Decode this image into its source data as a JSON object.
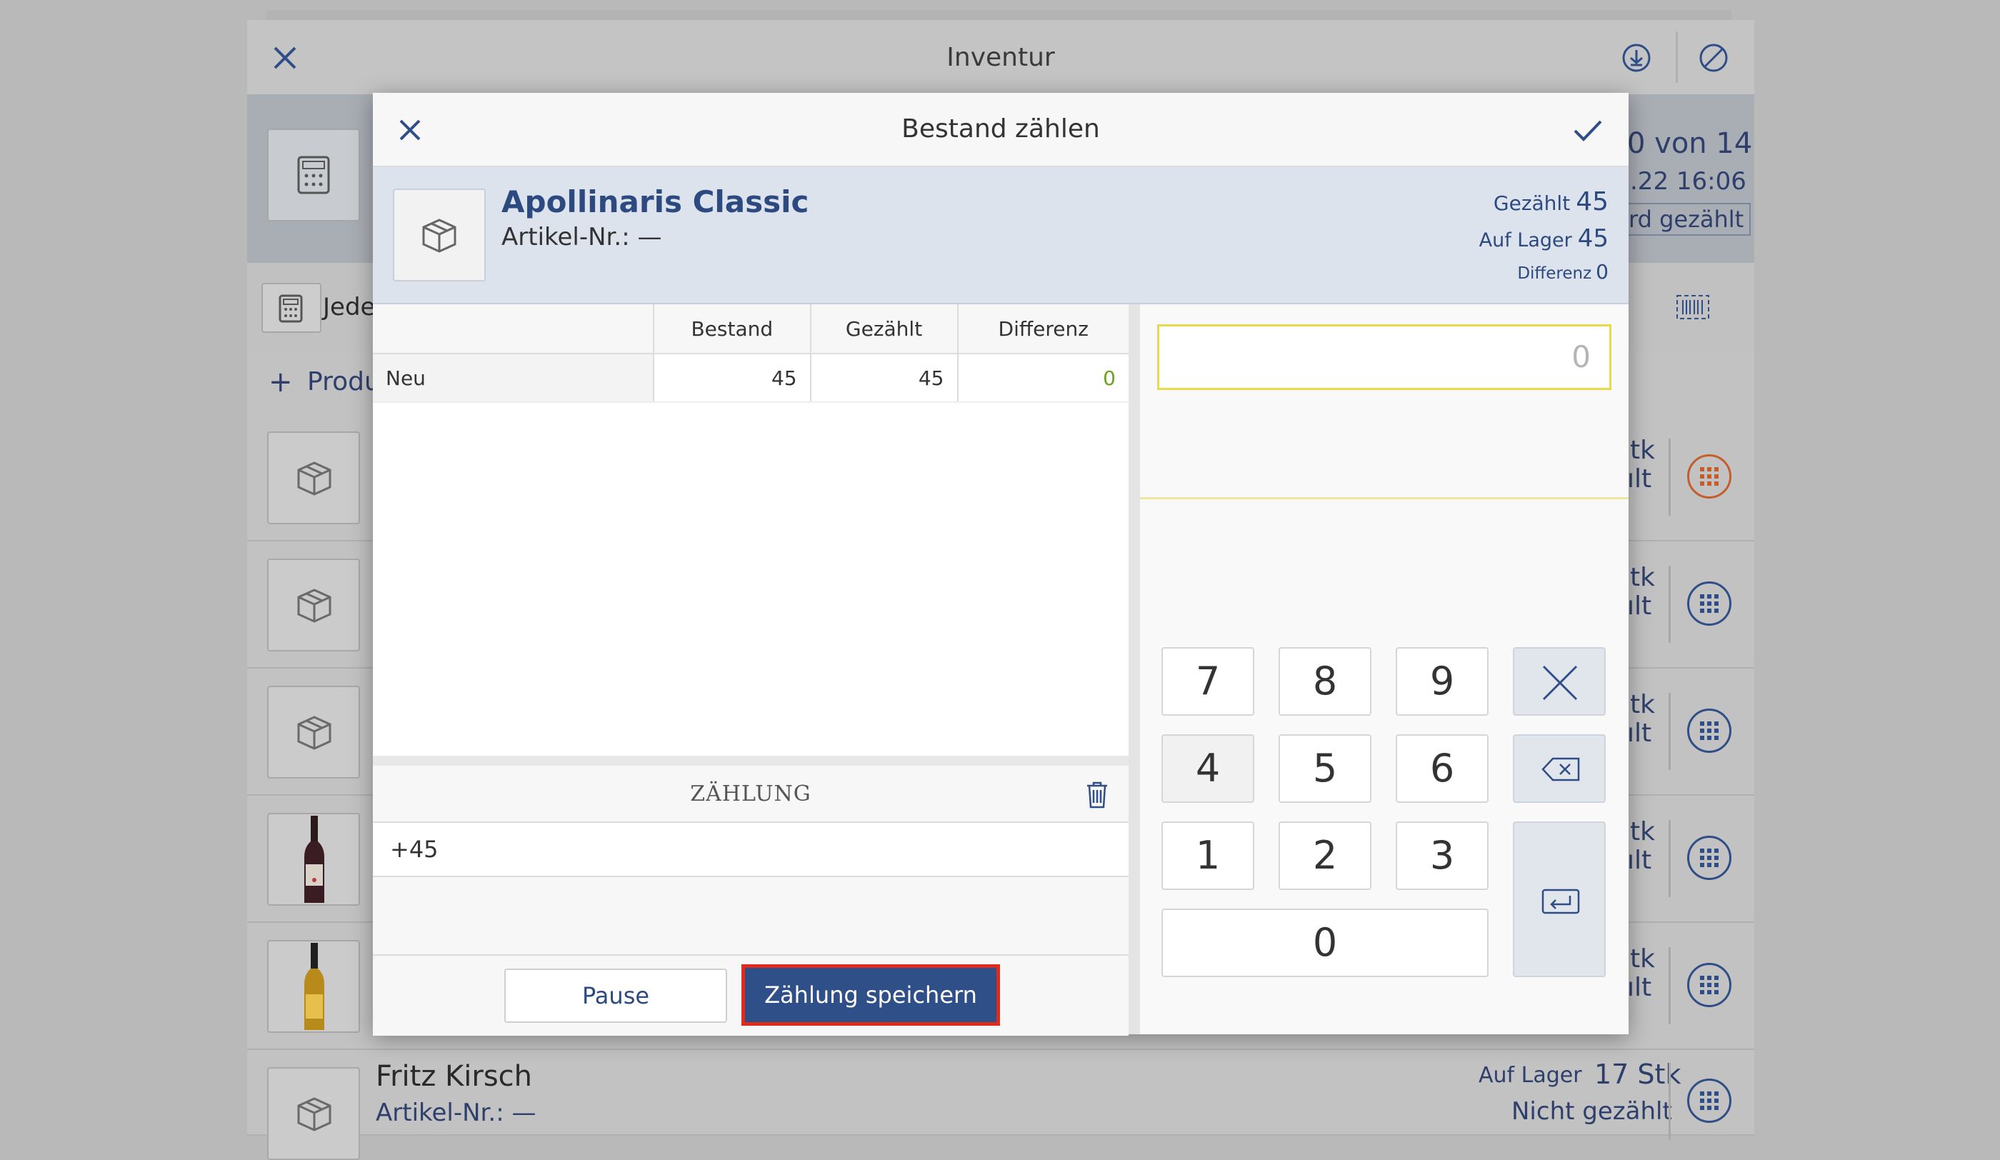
{
  "background": {
    "title": "Inventur",
    "count_text": "0 von 14",
    "date_text": ".22 16:06",
    "badge_text": "rd gezählt",
    "filter_text": "Jede",
    "add_text": "Produ",
    "row_partial_1": "tk",
    "row_partial_2": "ılt",
    "last_row": {
      "name": "Fritz Kirsch",
      "nr": "Artikel-Nr.: —",
      "stock_label": "Auf Lager",
      "stock_value": "17 Stk",
      "status": "Nicht gezählt"
    },
    "icons": [
      "close-icon",
      "download-icon",
      "cancel-icon",
      "calculator-icon",
      "barcode-icon",
      "box-icon",
      "bottle-image",
      "grid-icon"
    ]
  },
  "modal": {
    "title": "Bestand zählen",
    "product": {
      "name": "Apollinaris Classic",
      "nr": "Artikel-Nr.: —",
      "counted_label": "Gezählt",
      "counted_value": "45",
      "stock_label": "Auf Lager",
      "stock_value": "45",
      "diff_label": "Differenz",
      "diff_value": "0"
    },
    "table": {
      "headers": [
        "",
        "Bestand",
        "Gezählt",
        "Differenz"
      ],
      "rows": [
        {
          "label": "Neu",
          "bestand": "45",
          "gezaehlt": "45",
          "differenz": "0"
        }
      ]
    },
    "zaehlung": {
      "title": "ZÄHLUNG",
      "entries": [
        "+45"
      ]
    },
    "buttons": {
      "pause": "Pause",
      "save": "Zählung speichern"
    },
    "input_value": "0",
    "keypad": [
      "7",
      "8",
      "9",
      "4",
      "5",
      "6",
      "1",
      "2",
      "3",
      "0"
    ]
  },
  "colors": {
    "accent": "#2f4f88",
    "highlight_border": "#e02b1c",
    "input_border": "#e8da4a",
    "positive": "#6aa41e"
  }
}
